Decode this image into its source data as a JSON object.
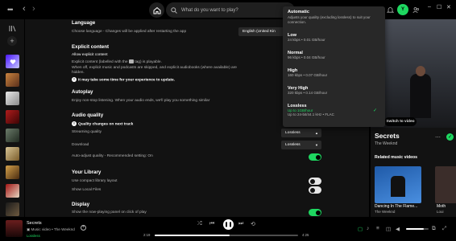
{
  "topbar": {
    "search_placeholder": "What do you want to play?",
    "user_initial": "Y"
  },
  "settings": {
    "language": {
      "title": "Language",
      "desc": "Choose language - Changes will be applied after restarting the app",
      "value": "English (United Kin"
    },
    "explicit": {
      "title": "Explicit content",
      "allow": "Allow explicit content",
      "line1_a": "Explicit content (labelled with the",
      "line1_b": "tag) is playable.",
      "line2": "When off, explicit music and podcasts are skipped, and explicit audiobooks (where available) are",
      "line3": "hidden.",
      "note": "It may take some time for your experience to update."
    },
    "autoplay": {
      "title": "Autoplay",
      "desc": "Enjoy non-stop listening. When your audio ends, we'll play you something similar"
    },
    "audio": {
      "title": "Audio quality",
      "note": "Quality changes on next track",
      "streaming_label": "Streaming quality",
      "streaming_value": "Lossless",
      "download_label": "Download",
      "download_value": "Lossless",
      "auto_adjust": "Auto-adjust quality - Recommended setting: On"
    },
    "library": {
      "title": "Your Library",
      "compact": "Use compact library layout",
      "local": "Show Local Files"
    },
    "display": {
      "title": "Display",
      "nowplaying": "Show the now-playing panel on click of play"
    },
    "toggles": {
      "auto_adjust": true,
      "compact": false,
      "local": false,
      "nowplaying": true
    }
  },
  "dropdown": {
    "items": [
      {
        "label": "Automatic",
        "desc": "Adjusts your quality (excluding lossless) to suit your connection.",
        "selected": false
      },
      {
        "label": "Low",
        "desc": "24 kbps • 0.01 GB/hour",
        "selected": false
      },
      {
        "label": "Normal",
        "desc": "96 kbps • 0.04 GB/hour",
        "selected": false
      },
      {
        "label": "High",
        "desc": "160 kbps • 0.07 GB/hour",
        "selected": false
      },
      {
        "label": "Very High",
        "desc": "320 kbps • 0.14 GB/hour",
        "selected": false
      },
      {
        "label": "Lossless",
        "desc": "Up to 1GB/hour",
        "desc2": "Up to 24-bit/44.1 kHz • FLAC",
        "selected": true
      }
    ]
  },
  "right_panel": {
    "header": "pify",
    "switch_label": "Switch to video",
    "title": "Secrets",
    "artist": "The Weeknd",
    "related_heading": "Related music videos",
    "cards": [
      {
        "title": "Dancing In The Flame...",
        "artist": "The Weeknd"
      },
      {
        "title": "Moth",
        "artist": "Loui"
      }
    ]
  },
  "player": {
    "title": "Secrets",
    "subtitle": "Music video • The Weeknd",
    "quality": "Lossless",
    "elapsed": "2:19",
    "duration": "4:25",
    "progress": 0.52,
    "volume": 0.8
  },
  "colors": {
    "accent": "#1ed760",
    "bg": "#121212",
    "surface": "#282828"
  }
}
